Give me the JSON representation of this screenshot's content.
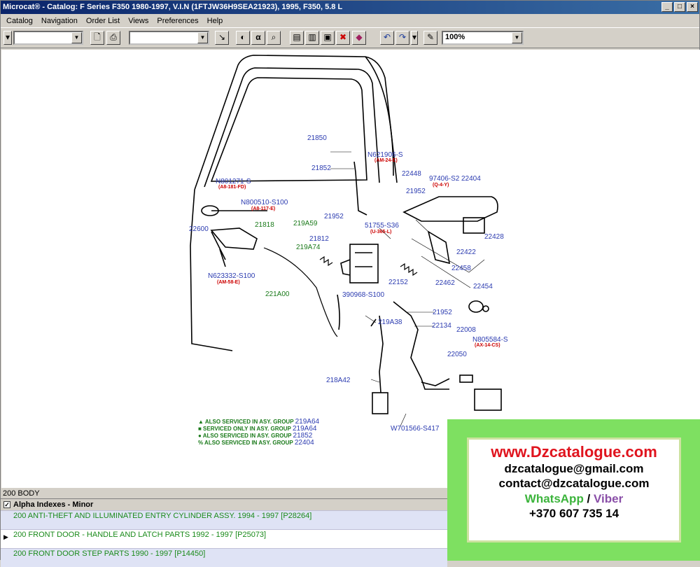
{
  "window": {
    "title": "Microcat® - Catalog: F Series F350 1980-1997, V.I.N (1FTJW36H9SEA21923), 1995, F350, 5.8 L"
  },
  "menu": [
    "Catalog",
    "Navigation",
    "Order List",
    "Views",
    "Preferences",
    "Help"
  ],
  "toolbar": {
    "zoom": "100%"
  },
  "diagram": {
    "labels": [
      {
        "t": "21850"
      },
      {
        "t": "N621906-S"
      },
      {
        "t": "21852"
      },
      {
        "t": "22448"
      },
      {
        "t": "97406-S2"
      },
      {
        "t": "22404"
      },
      {
        "t": "N801271-S"
      },
      {
        "t": "21952"
      },
      {
        "t": "N800510-S100"
      },
      {
        "t": "21952"
      },
      {
        "t": "219A59"
      },
      {
        "t": "21818"
      },
      {
        "t": "51755-S36"
      },
      {
        "t": "22600"
      },
      {
        "t": "21812"
      },
      {
        "t": "22428"
      },
      {
        "t": "219A74"
      },
      {
        "t": "22422"
      },
      {
        "t": "N623332-S100"
      },
      {
        "t": "22458"
      },
      {
        "t": "22152"
      },
      {
        "t": "22462"
      },
      {
        "t": "22454"
      },
      {
        "t": "221A00"
      },
      {
        "t": "390968-S100"
      },
      {
        "t": "21952"
      },
      {
        "t": "219A38"
      },
      {
        "t": "22134"
      },
      {
        "t": "22008"
      },
      {
        "t": "N805584-S"
      },
      {
        "t": "22050"
      },
      {
        "t": "218A42"
      },
      {
        "t": "W701566-S417"
      }
    ],
    "refs": [
      "(AM-24-E)",
      "(Q-4-Y)",
      "(A8-181-FD)",
      "(A8-117-E)",
      "(U-365-L)",
      "(AM-58-E)",
      "(AX-14-CS)"
    ],
    "legend": [
      {
        "text": "▲ ALSO SERVICED IN ASY. GROUP",
        "num": "219A64"
      },
      {
        "text": "■ SERVICED ONLY IN ASY. GROUP",
        "num": "219A64"
      },
      {
        "text": "● ALSO SERVICED IN ASY. GROUP",
        "num": "21852"
      },
      {
        "text": "% ALSO SERVICED IN ASY. GROUP",
        "num": "22404"
      }
    ]
  },
  "ad": {
    "url": "www.Dzcatalogue.com",
    "email1": "dzcatalogue@gmail.com",
    "email2": "contact@dzcatalogue.com",
    "whatsapp": "WhatsApp",
    "sep": " / ",
    "viber": "Viber",
    "phone": "+370 607 735 14"
  },
  "bottom": {
    "group": "200   BODY",
    "alpha": "Alpha Indexes - Minor",
    "rows": [
      "200  ANTI-THEFT AND ILLUMINATED ENTRY CYLINDER ASSY. 1994 - 1997 [P28264]",
      "200  FRONT DOOR - HANDLE AND LATCH PARTS 1992 - 1997 [P25073]",
      "200  FRONT DOOR STEP PARTS 1990 - 1997 [P14450]"
    ]
  }
}
